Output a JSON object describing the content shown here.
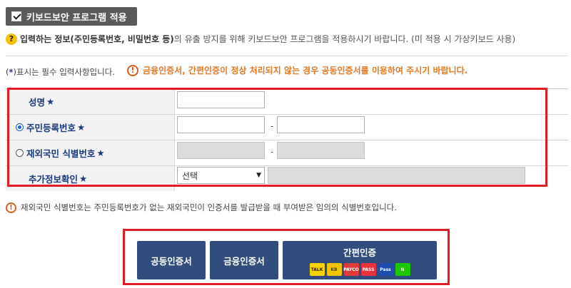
{
  "keyboard_security": {
    "label": "키보드보안 프로그램 적용",
    "checked": true
  },
  "info": {
    "bold_part": "입력하는 정보(주민등록번호, 비밀번호 등)",
    "normal_part": "의 유출 방지를 위해 키보드보안 프로그램을 적용하시기 바랍니다. (미 적용 시 가상키보드 사용)"
  },
  "required_notice": {
    "star": "*",
    "text": "표시는 필수 입력사항입니다."
  },
  "warning": "금융인증서, 간편인증이 정상 처리되지 않는 경우 공동인증서를 이용하여 주시기 바랍니다.",
  "form": {
    "name_label": "성명",
    "rrn_label": "주민등록번호",
    "foreign_label": "재외국민 식별번호",
    "extra_label": "추가정보확인",
    "dash": "-",
    "select_value": "선택",
    "star": "★"
  },
  "footnote": "재외국민 식별번호는 주민등록번호가 없는 재외국민이 인증서를 발급받을 때 부여받은 임의의 식별번호입니다.",
  "auth": {
    "joint": "공동인증서",
    "financial": "금융인증서",
    "simple": "간편인증",
    "providers": [
      {
        "name": "kakao-talk",
        "text": "TALK",
        "color": "#f7d300",
        "fg": "#3b1e1e"
      },
      {
        "name": "kb",
        "text": "KB",
        "color": "#f5c400",
        "fg": "#4a3b00"
      },
      {
        "name": "payco",
        "text": "PAYCO",
        "color": "#e03a3a",
        "fg": "#ffffff"
      },
      {
        "name": "pass",
        "text": "PASS",
        "color": "#e8323c",
        "fg": "#ffffff"
      },
      {
        "name": "samsung-pass",
        "text": "Pass",
        "color": "#1d4db3",
        "fg": "#ffffff"
      },
      {
        "name": "naver",
        "text": "N",
        "color": "#1ec800",
        "fg": "#ffffff"
      }
    ]
  },
  "colors": {
    "accent_red": "#e01c24",
    "button_blue": "#304d7e",
    "warning_orange": "#e87722",
    "label_blue": "#1b3a7a"
  }
}
